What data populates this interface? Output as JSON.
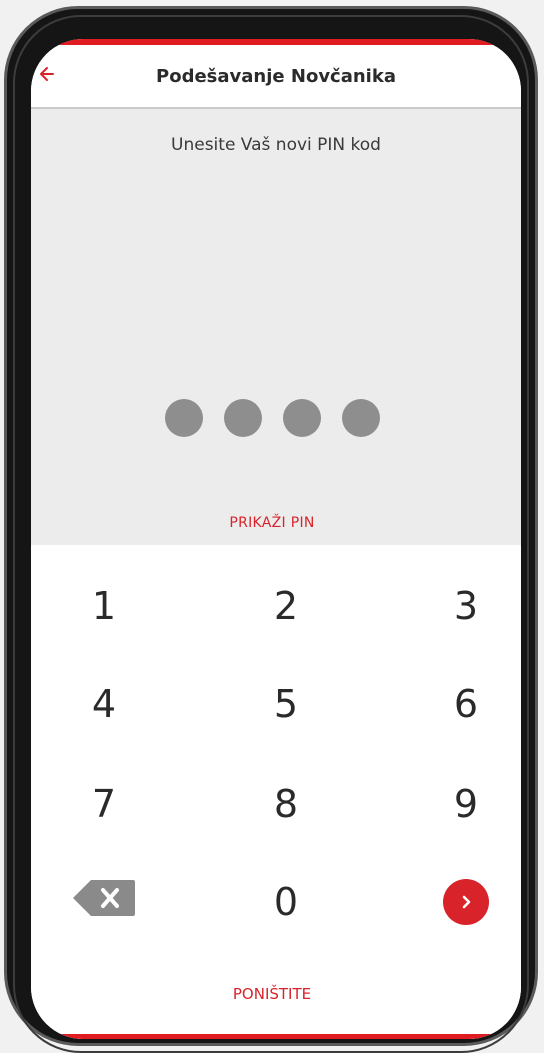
{
  "header": {
    "title": "Podešavanje Novčanika",
    "back_icon": "back-arrow-icon"
  },
  "pin_entry": {
    "prompt": "Unesite Vaš novi PIN kod",
    "dots_filled": 4,
    "show_pin_label": "PRIKAŽI PIN"
  },
  "keypad": {
    "keys": [
      "1",
      "2",
      "3",
      "4",
      "5",
      "6",
      "7",
      "8",
      "9",
      "0"
    ],
    "backspace_icon": "backspace-icon",
    "next_icon": "chevron-right-icon"
  },
  "footer": {
    "cancel_label": "PONIŠTITE"
  },
  "colors": {
    "accent": "#d8232a",
    "entry_background": "#ececec",
    "dot": "#8e8e8e"
  }
}
